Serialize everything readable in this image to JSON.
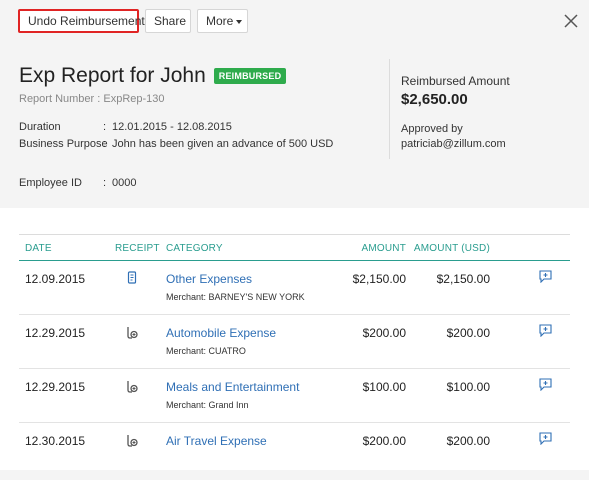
{
  "toolbar": {
    "undo_label": "Undo Reimbursement",
    "share_label": "Share",
    "more_label": "More"
  },
  "report": {
    "title": "Exp Report for John",
    "status_badge": "REIMBURSED",
    "report_number": "Report Number : ExpRep-130",
    "duration_label": "Duration",
    "duration_value": "12.01.2015 - 12.08.2015",
    "purpose_label": "Business Purpose",
    "purpose_value": "John has been given an advance of 500 USD",
    "employee_label": "Employee ID",
    "employee_value": "0000",
    "colon": ":"
  },
  "summary": {
    "reimbursed_label": "Reimbursed Amount",
    "reimbursed_amount": "$2,650.00",
    "approved_label": "Approved by",
    "approved_by": "patriciab@zillum.com"
  },
  "table": {
    "headers": [
      "DATE",
      "RECEIPT",
      "CATEGORY",
      "AMOUNT",
      "AMOUNT (USD)"
    ],
    "rows": [
      {
        "date": "12.09.2015",
        "category": "Other Expenses",
        "merchant": "Merchant: BARNEY'S NEW YORK",
        "amount": "$2,150.00",
        "amount_usd": "$2,150.00",
        "receipt": "attachment"
      },
      {
        "date": "12.29.2015",
        "category": "Automobile Expense",
        "merchant": "Merchant: CUATRO",
        "amount": "$200.00",
        "amount_usd": "$200.00",
        "receipt": "none"
      },
      {
        "date": "12.29.2015",
        "category": "Meals and Entertainment",
        "merchant": "Merchant: Grand Inn",
        "amount": "$100.00",
        "amount_usd": "$100.00",
        "receipt": "none"
      },
      {
        "date": "12.30.2015",
        "category": "Air Travel Expense",
        "merchant": "",
        "amount": "$200.00",
        "amount_usd": "$200.00",
        "receipt": "none"
      }
    ]
  },
  "colors": {
    "badge": "#2eab4c",
    "accent": "#2a9d8f",
    "link": "#2f6fb5",
    "highlight_border": "#e02424"
  }
}
